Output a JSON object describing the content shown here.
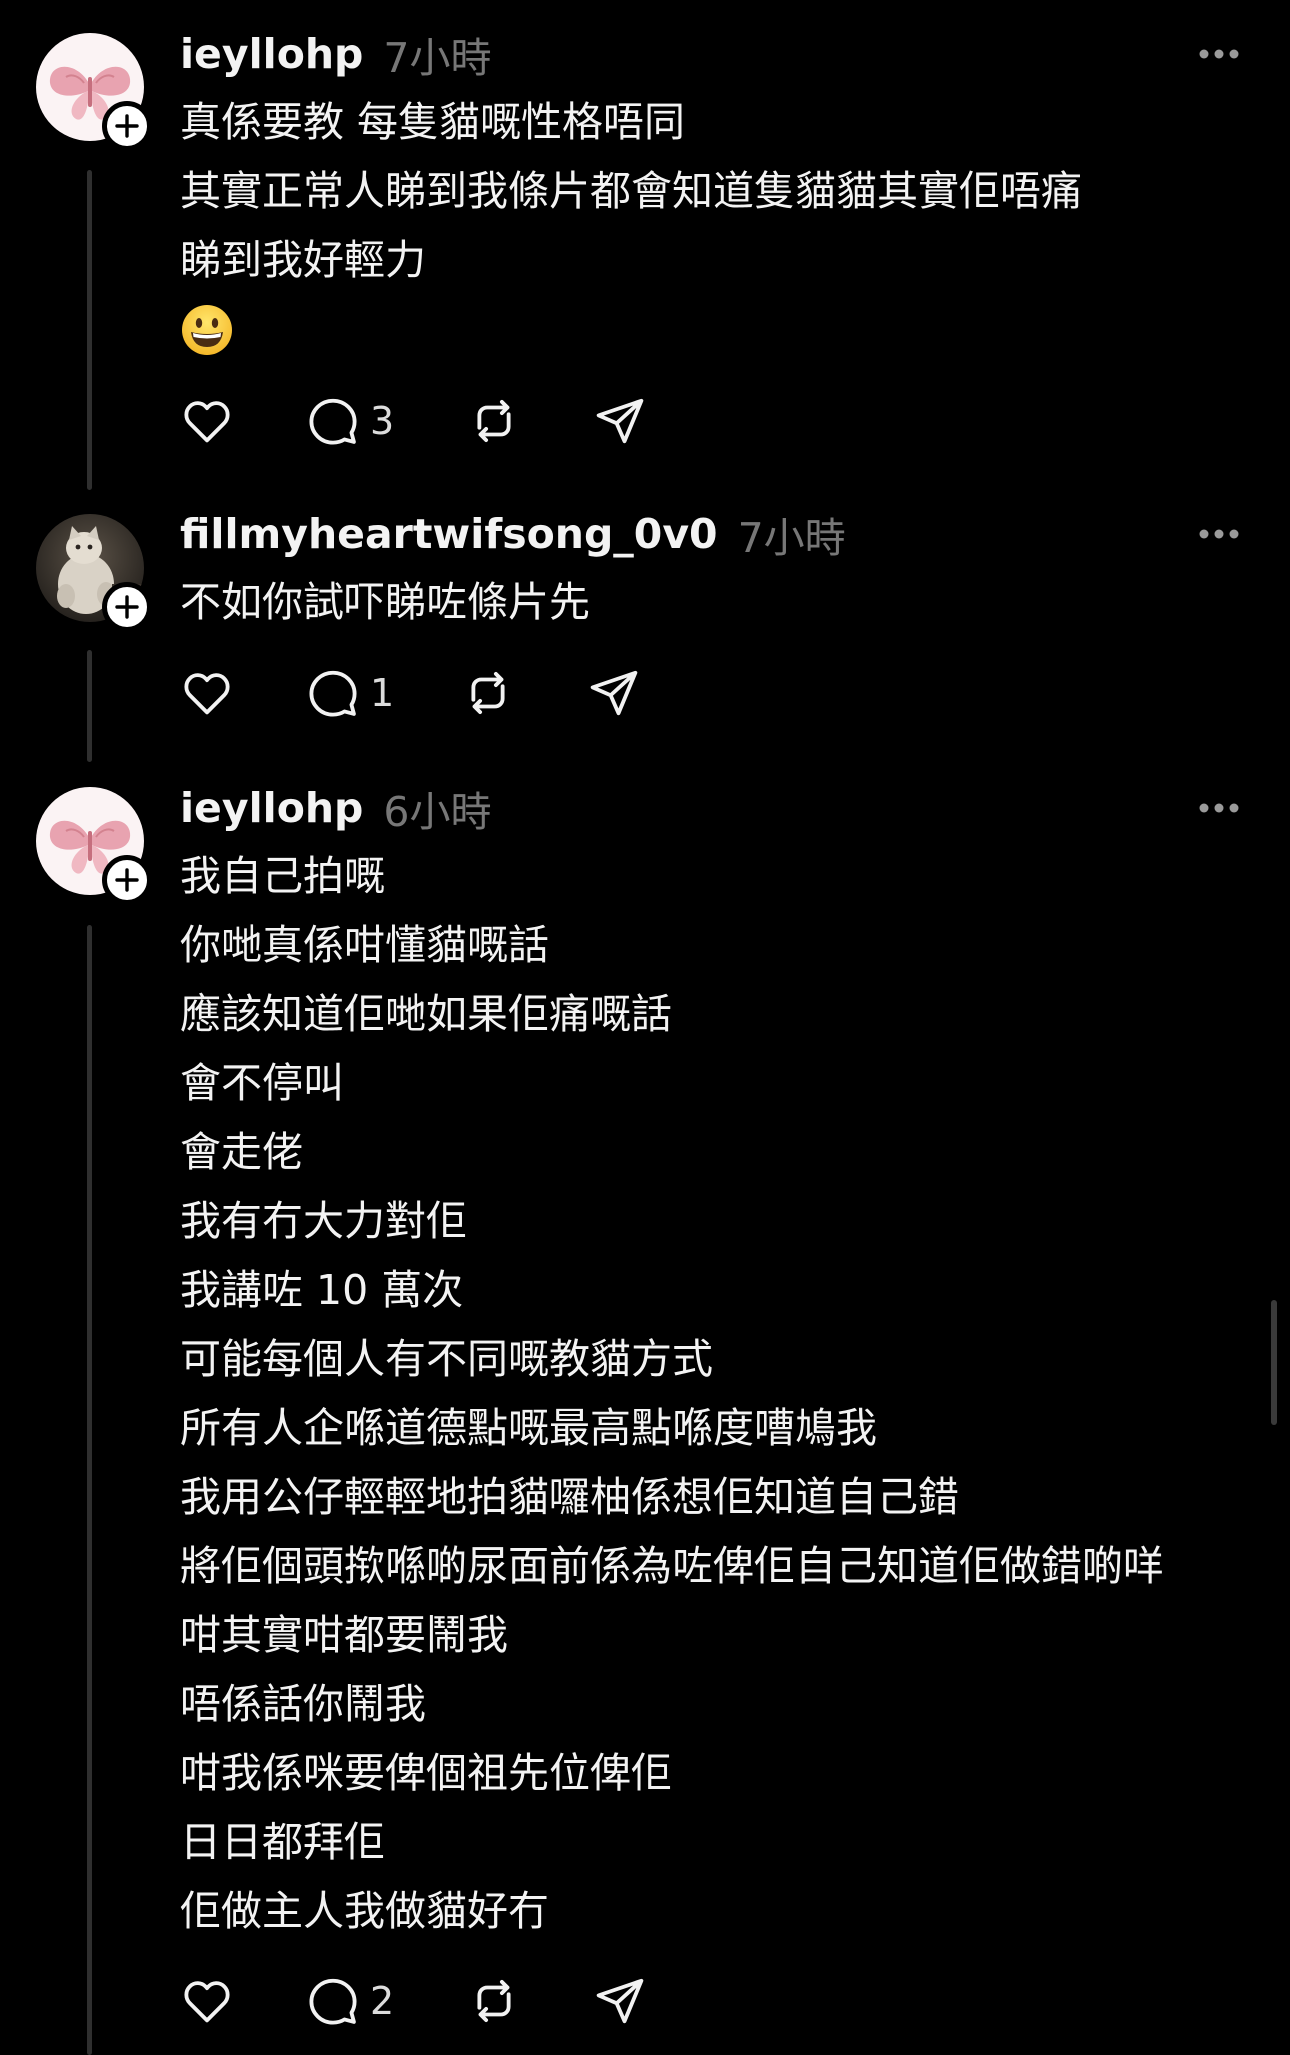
{
  "posts": [
    {
      "username": "ieyllohp",
      "time": "7小時",
      "lines": [
        "真係要教 每隻貓嘅性格唔同",
        "其實正常人睇到我條片都會知道隻貓貓其實佢唔痛",
        "睇到我好輕力"
      ],
      "emoji": "grinning-face",
      "reply_count": "3"
    },
    {
      "username": "fillmyheartwifsong_0v0",
      "time": "7小時",
      "lines": [
        "不如你試吓睇咗條片先"
      ],
      "reply_count": "1"
    },
    {
      "username": "ieyllohp",
      "time": "6小時",
      "lines": [
        "我自己拍嘅",
        "你哋真係咁懂貓嘅話",
        "應該知道佢哋如果佢痛嘅話",
        "會不停叫",
        "會走佬",
        "我有冇大力對佢",
        "我講咗 10 萬次",
        "可能每個人有不同嘅教貓方式",
        "所有人企喺道德點嘅最高點喺度嘈鳩我",
        "我用公仔輕輕地拍貓囉柚係想佢知道自己錯",
        "將佢個頭揿喺啲尿面前係為咗俾佢自己知道佢做錯啲咩",
        "咁其實咁都要鬧我",
        "唔係話你鬧我",
        "咁我係咪要俾個祖先位俾佢",
        "日日都拜佢",
        "佢做主人我做貓好冇"
      ],
      "reply_count": "2"
    }
  ],
  "icons": {
    "like": "heart-icon",
    "reply": "comment-bubble-icon",
    "repost": "repost-icon",
    "share": "send-icon",
    "more": "more-dots-icon",
    "follow": "plus-icon"
  },
  "colors": {
    "background": "#000000",
    "text": "#f3f3f3",
    "muted": "#777777",
    "thread_line": "#2f2f2f"
  }
}
